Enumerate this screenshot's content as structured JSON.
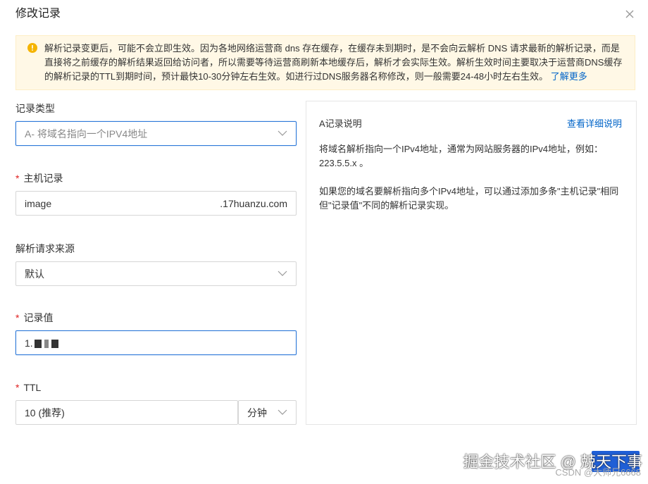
{
  "dialog": {
    "title": "修改记录",
    "close_icon": "close-icon"
  },
  "notice": {
    "icon": "info-icon",
    "icon_color": "#f5b400",
    "text": "解析记录变更后，可能不会立即生效。因为各地网络运营商 dns 存在缓存，在缓存未到期时，是不会向云解析 DNS 请求最新的解析记录，而是直接将之前缓存的解析结果返回给访问者，所以需要等待运营商刷新本地缓存后，解析才会实际生效。解析生效时间主要取决于运营商DNS缓存的解析记录的TTL到期时间，预计最快10-30分钟左右生效。如进行过DNS服务器名称修改，则一般需要24-48小时左右生效。",
    "link": "了解更多"
  },
  "form": {
    "record_type": {
      "label": "记录类型",
      "value": "A- 将域名指向一个IPV4地址"
    },
    "host": {
      "required": "*",
      "label": "主机记录",
      "value": "image",
      "suffix": ".17huanzu.com"
    },
    "source": {
      "label": "解析请求来源",
      "value": "默认"
    },
    "record_value": {
      "required": "*",
      "label": "记录值",
      "value": "1."
    },
    "ttl": {
      "required": "*",
      "label": "TTL",
      "value": "10 (推荐)",
      "unit": "分钟"
    }
  },
  "side": {
    "title": "A记录说明",
    "link": "查看详细说明",
    "p1": "将域名解析指向一个IPv4地址，通常为网站服务器的IPv4地址，例如：223.5.5.x 。",
    "p2": "如果您的域名要解析指向多个IPv4地址，可以通过添加多条\"主机记录\"相同但\"记录值\"不同的解析记录实现。"
  },
  "overlay": {
    "watermark": "掘金技术社区 @ 兢天下事",
    "csdn": "CSDN @大师兄6668"
  },
  "colors": {
    "accent": "#0064c8",
    "focus": "#2f7ad9",
    "button": "#1f5fd6",
    "notice_bg": "#fff8e6"
  }
}
